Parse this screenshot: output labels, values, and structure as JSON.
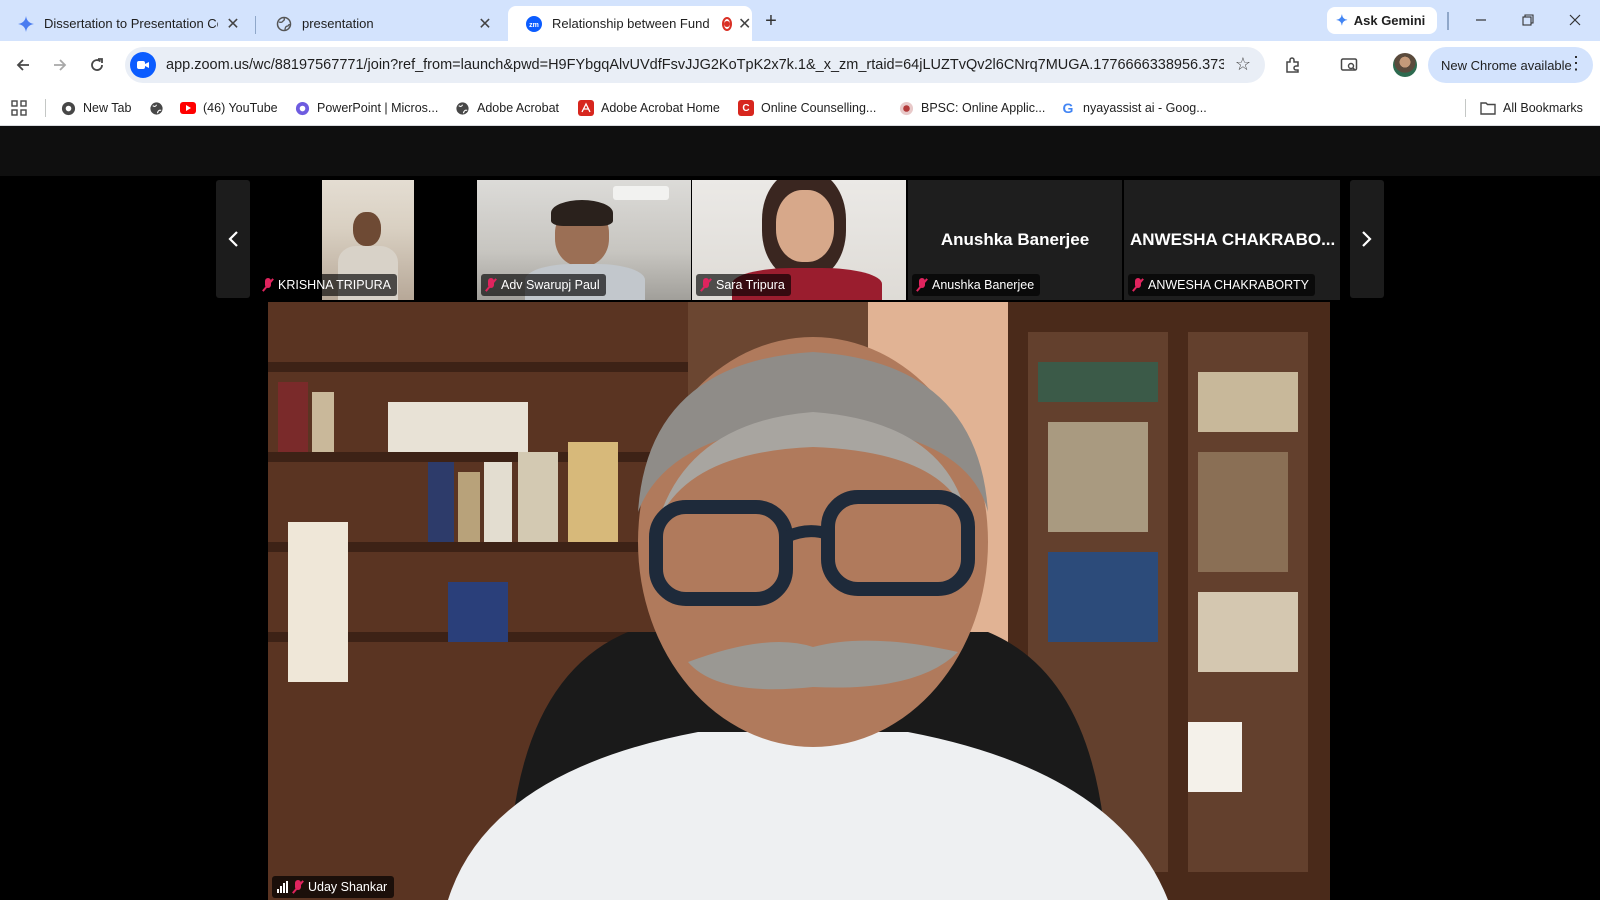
{
  "browser": {
    "tabs": [
      {
        "title": "Dissertation to Presentation Co",
        "icon": "gemini-icon",
        "active": false
      },
      {
        "title": "presentation",
        "icon": "globe-icon",
        "active": false
      },
      {
        "title": "Relationship between Fund",
        "icon": "zoom-icon",
        "active": true,
        "recording": true
      }
    ],
    "ask_gemini": "Ask Gemini",
    "url": "app.zoom.us/wc/88197567771/join?ref_from=launch&pwd=H9FYbgqAlvUVdfFsvJJG2KoTpK2x7k.1&_x_zm_rtaid=64jLUZTvQv2l6CNrq7MUGA.1776666338956.3737...",
    "update_label": "New Chrome available",
    "bookmarks": [
      {
        "label": "New Tab",
        "icon": "chrome-icon"
      },
      {
        "label": "",
        "icon": "globe-icon"
      },
      {
        "label": "(46) YouTube",
        "icon": "youtube-icon"
      },
      {
        "label": "PowerPoint | Micros...",
        "icon": "powerpoint-icon"
      },
      {
        "label": "Adobe Acrobat",
        "icon": "globe-icon"
      },
      {
        "label": "Adobe Acrobat Home",
        "icon": "acrobat-icon"
      },
      {
        "label": "Online Counselling...",
        "icon": "counselling-icon"
      },
      {
        "label": "BPSC: Online Applic...",
        "icon": "bpsc-icon"
      },
      {
        "label": "nyayassist ai - Goog...",
        "icon": "google-icon"
      }
    ],
    "all_bookmarks": "All Bookmarks"
  },
  "meeting": {
    "participants": [
      {
        "name": "KRISHNA TRIPURA",
        "muted": true,
        "video": true
      },
      {
        "name": "Adv Swarupj Paul",
        "muted": true,
        "video": true
      },
      {
        "name": "Sara Tripura",
        "muted": true,
        "video": true
      },
      {
        "name": "Anushka Banerjee",
        "display_name": "Anushka Banerjee",
        "muted": true,
        "video": false
      },
      {
        "name": "ANWESHA CHAKRABORTY",
        "display_name": "ANWESHA CHAKRABO...",
        "muted": true,
        "video": false
      }
    ],
    "active_speaker": {
      "name": "Uday Shankar",
      "muted": true
    }
  },
  "colors": {
    "tabstrip": "#d3e3fd",
    "zoom_blue": "#0b5cff",
    "muted_red": "#e0245e",
    "record_red": "#d93025"
  }
}
